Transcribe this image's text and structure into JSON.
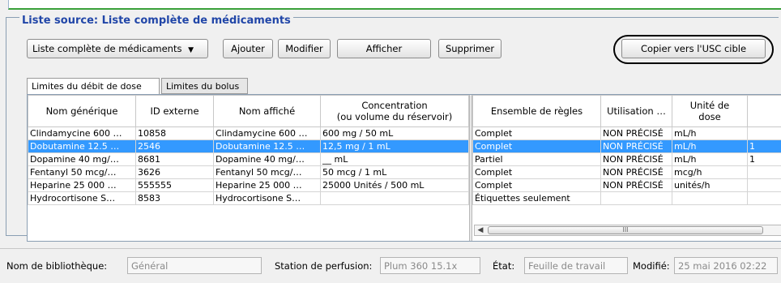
{
  "group": {
    "title": "Liste source: Liste complète de médicaments"
  },
  "toolbar": {
    "list_select": "Liste complète de médicaments",
    "add_label": "Ajouter",
    "modify_label": "Modifier",
    "display_label": "Afficher",
    "delete_label": "Supprimer",
    "copy_label": "Copier vers l'USC cible"
  },
  "tabs": [
    {
      "label": "Limites du débit de dose",
      "active": true
    },
    {
      "label": "Limites du bolus",
      "active": false
    }
  ],
  "left_table": {
    "headers": [
      "Nom générique",
      "ID externe",
      "Nom affiché",
      "Concentration",
      "(ou volume du réservoir)"
    ],
    "rows": [
      {
        "generic": "Clindamycine 600 …",
        "id": "10858",
        "display": "Clindamycine 600 …",
        "conc": "600 mg / 50 mL"
      },
      {
        "generic": "Dobutamine 12.5 …",
        "id": "2546",
        "display": "Dobutamine 12.5 …",
        "conc": "12,5 mg / 1 mL"
      },
      {
        "generic": "Dopamine 40 mg/…",
        "id": "8681",
        "display": "Dopamine 40 mg/…",
        "conc": "__ mL"
      },
      {
        "generic": "Fentanyl 50 mcg/…",
        "id": "3626",
        "display": "Fentanyl 50 mcg/…",
        "conc": "50 mcg / 1 mL"
      },
      {
        "generic": "Heparine 25 000 …",
        "id": "555555",
        "display": "Heparine 25 000 …",
        "conc": "25000 Unités / 500 mL"
      },
      {
        "generic": "Hydrocortisone S…",
        "id": "8583",
        "display": "Hydrocortisone S…",
        "conc": ""
      }
    ]
  },
  "right_table": {
    "headers": [
      "Ensemble de règles",
      "Utilisation …",
      "Unité de",
      "dose"
    ],
    "rows": [
      {
        "rules": "Complet",
        "usage": "NON PRÉCISÉ",
        "unit": "mL/h",
        "extra": ""
      },
      {
        "rules": "Complet",
        "usage": "NON PRÉCISÉ",
        "unit": "mL/h",
        "extra": "1"
      },
      {
        "rules": "Partiel",
        "usage": "NON PRÉCISÉ",
        "unit": "mL/h",
        "extra": "1"
      },
      {
        "rules": "Complet",
        "usage": "NON PRÉCISÉ",
        "unit": "mcg/h",
        "extra": ""
      },
      {
        "rules": "Complet",
        "usage": "NON PRÉCISÉ",
        "unit": "unités/h",
        "extra": ""
      },
      {
        "rules": "Étiquettes seulement",
        "usage": "",
        "unit": "",
        "extra": ""
      }
    ]
  },
  "selected_row": 1,
  "scrollbar": {
    "grip": "III"
  },
  "status": {
    "library_label": "Nom de bibliothèque:",
    "library_value": "Général",
    "station_label": "Station de perfusion:",
    "station_value": "Plum 360 15.1x",
    "state_label": "État:",
    "state_value": "Feuille de travail",
    "modified_label": "Modifié:",
    "modified_value": "25 mai 2016 02:22"
  },
  "colors": {
    "title": "#2146a8",
    "selection": "#3399ff",
    "top_accent": "#3aa13a"
  }
}
